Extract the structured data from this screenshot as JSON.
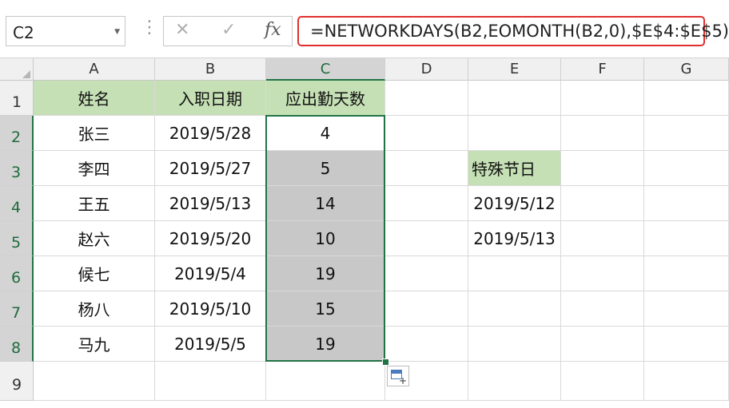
{
  "name_box": {
    "value": "C2"
  },
  "formula_bar": {
    "cancel_glyph": "✕",
    "enter_glyph": "✓",
    "fx_label": "fx",
    "formula": "=NETWORKDAYS(B2,EOMONTH(B2,0),$E$4:$E$5)"
  },
  "columns": [
    "A",
    "B",
    "C",
    "D",
    "E",
    "F",
    "G"
  ],
  "rows": [
    "1",
    "2",
    "3",
    "4",
    "5",
    "6",
    "7",
    "8",
    "9"
  ],
  "table": {
    "headers": {
      "name": "姓名",
      "hire_date": "入职日期",
      "work_days": "应出勤天数"
    },
    "records": [
      {
        "name": "张三",
        "hire_date": "2019/5/28",
        "work_days": "4"
      },
      {
        "name": "李四",
        "hire_date": "2019/5/27",
        "work_days": "5"
      },
      {
        "name": "王五",
        "hire_date": "2019/5/13",
        "work_days": "14"
      },
      {
        "name": "赵六",
        "hire_date": "2019/5/20",
        "work_days": "10"
      },
      {
        "name": "候七",
        "hire_date": "2019/5/4",
        "work_days": "19"
      },
      {
        "name": "杨八",
        "hire_date": "2019/5/10",
        "work_days": "15"
      },
      {
        "name": "马九",
        "hire_date": "2019/5/5",
        "work_days": "19"
      }
    ]
  },
  "holidays": {
    "header": "特殊节日",
    "dates": [
      "2019/5/12",
      "2019/5/13"
    ]
  },
  "colors": {
    "header_fill": "#c5e0b4",
    "selection": "#217346",
    "formula_highlight": "#e0302e",
    "selected_fill": "#c8c8c8"
  }
}
